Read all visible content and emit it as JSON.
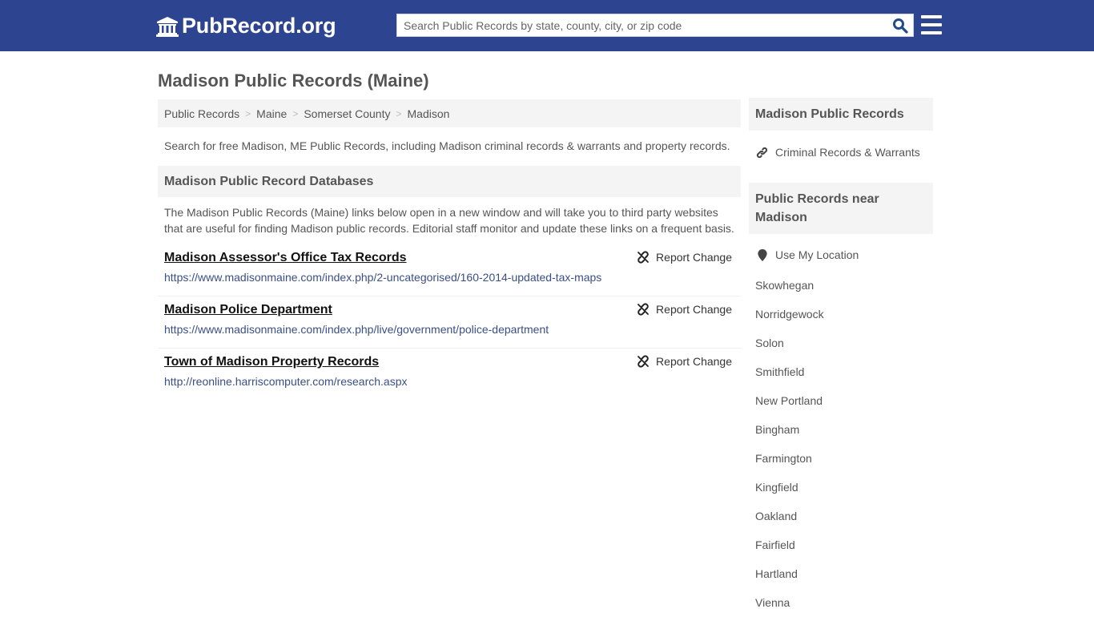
{
  "header": {
    "logo_text": "PubRecord.org",
    "search_placeholder": "Search Public Records by state, county, city, or zip code",
    "search_value": ""
  },
  "page": {
    "title": "Madison Public Records (Maine)"
  },
  "breadcrumb": [
    {
      "label": "Public Records"
    },
    {
      "label": "Maine"
    },
    {
      "label": "Somerset County"
    },
    {
      "label": "Madison"
    }
  ],
  "breadcrumb_separator": ">",
  "intro": "Search for free Madison, ME Public Records, including Madison criminal records & warrants and property records.",
  "databases": {
    "heading": "Madison Public Record Databases",
    "description": "The Madison Public Records (Maine) links below open in a new window and will take you to third party websites that are useful for finding Madison public records. Editorial staff monitor and update these links on a frequent basis.",
    "report_label": "Report Change",
    "records": [
      {
        "title": "Madison Assessor's Office Tax Records",
        "url": "https://www.madisonmaine.com/index.php/2-uncategorised/160-2014-updated-tax-maps"
      },
      {
        "title": "Madison Police Department",
        "url": "https://www.madisonmaine.com/index.php/live/government/police-department"
      },
      {
        "title": "Town of Madison Property Records",
        "url": "http://reonline.harriscomputer.com/research.aspx"
      }
    ]
  },
  "sidebar": {
    "section1_heading": "Madison Public Records",
    "section1_links": [
      {
        "label": "Criminal Records & Warrants",
        "icon": "link-icon"
      }
    ],
    "section2_heading": "Public Records near Madison",
    "location_label": "Use My Location",
    "nearby": [
      "Skowhegan",
      "Norridgewock",
      "Solon",
      "Smithfield",
      "New Portland",
      "Bingham",
      "Farmington",
      "Kingfield",
      "Oakland",
      "Fairfield",
      "Hartland",
      "Vienna"
    ]
  },
  "colors": {
    "header_bg": "#2d4590",
    "search_icon": "#1f4b8f",
    "url_link": "#3a4f86",
    "panel_bg": "#f4f4f4"
  }
}
